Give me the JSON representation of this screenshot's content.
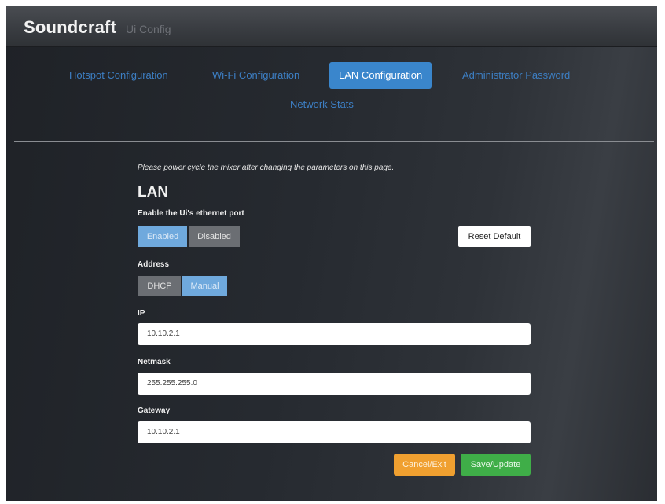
{
  "header": {
    "brand": "Soundcraft",
    "subtitle": "Ui Config"
  },
  "nav": {
    "tabs": [
      {
        "label": "Hotspot Configuration",
        "active": false
      },
      {
        "label": "Wi-Fi Configuration",
        "active": false
      },
      {
        "label": "LAN Configuration",
        "active": true
      },
      {
        "label": "Administrator Password",
        "active": false
      },
      {
        "label": "Network Stats",
        "active": false
      }
    ]
  },
  "main": {
    "notice": "Please power cycle the mixer after changing the parameters on this page.",
    "section_title": "LAN",
    "ethernet": {
      "label": "Enable the Ui's ethernet port",
      "options": [
        "Enabled",
        "Disabled"
      ],
      "selected": "Enabled"
    },
    "reset_label": "Reset Default",
    "address": {
      "label": "Address",
      "options": [
        "DHCP",
        "Manual"
      ],
      "selected": "Manual"
    },
    "ip": {
      "label": "IP",
      "value": "10.10.2.1"
    },
    "netmask": {
      "label": "Netmask",
      "value": "255.255.255.0"
    },
    "gateway": {
      "label": "Gateway",
      "value": "10.10.2.1"
    },
    "cancel_label": "Cancel/Exit",
    "save_label": "Save/Update"
  },
  "colors": {
    "accent": "#3a86cc",
    "cancel": "#f0a030",
    "save": "#3fae48",
    "toggle_on": "#6fa9dd",
    "toggle_off": "#6b6e73"
  }
}
